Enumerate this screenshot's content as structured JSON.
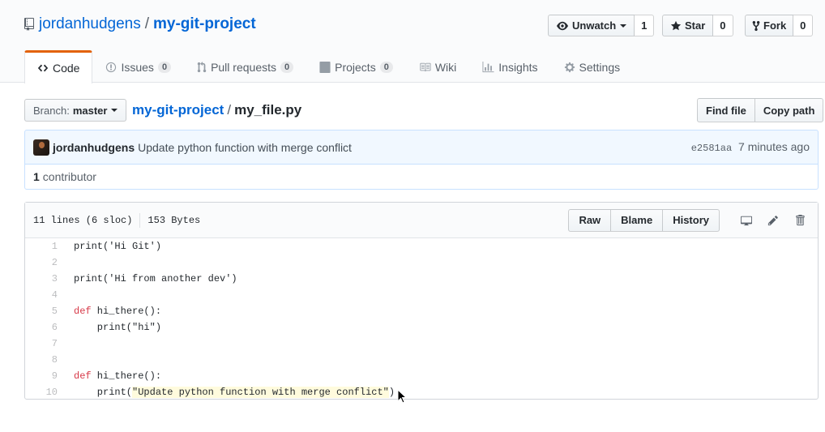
{
  "repo": {
    "owner": "jordanhudgens",
    "separator": "/",
    "name": "my-git-project"
  },
  "actions": {
    "unwatch_label": "Unwatch",
    "watch_count": "1",
    "star_label": "Star",
    "star_count": "0",
    "fork_label": "Fork",
    "fork_count": "0"
  },
  "nav": {
    "code": "Code",
    "issues": "Issues",
    "issues_count": "0",
    "pulls": "Pull requests",
    "pulls_count": "0",
    "projects": "Projects",
    "projects_count": "0",
    "wiki": "Wiki",
    "insights": "Insights",
    "settings": "Settings"
  },
  "branch": {
    "label": "Branch:",
    "name": "master"
  },
  "breadcrumb": {
    "root": "my-git-project",
    "separator": "/",
    "file": "my_file.py"
  },
  "file_buttons": {
    "find": "Find file",
    "copy": "Copy path"
  },
  "commit": {
    "author": "jordanhudgens",
    "message": "Update python function with merge conflict",
    "sha": "e2581aa",
    "time": "7 minutes ago"
  },
  "contributors": {
    "count": "1",
    "label": "contributor"
  },
  "file": {
    "lines": "11 lines (6 sloc)",
    "size": "153 Bytes",
    "raw": "Raw",
    "blame": "Blame",
    "history": "History"
  },
  "code_lines": [
    {
      "num": "1",
      "text": "print('Hi Git')"
    },
    {
      "num": "2",
      "text": ""
    },
    {
      "num": "3",
      "text": "print('Hi from another dev')"
    },
    {
      "num": "4",
      "text": ""
    },
    {
      "num": "5",
      "kw": "def",
      "text": " hi_there():"
    },
    {
      "num": "6",
      "text": "    print(\"hi\")"
    },
    {
      "num": "7",
      "text": ""
    },
    {
      "num": "8",
      "text": ""
    },
    {
      "num": "9",
      "kw": "def",
      "text": " hi_there():"
    },
    {
      "num": "10",
      "pre": "    print(",
      "hl": "\"Update python function with merge conflict\"",
      "post": ")"
    }
  ],
  "colors": {
    "link": "#0366d6",
    "tab_accent": "#e36209",
    "keyword": "#d73a49",
    "highlight": "#fffbdd"
  }
}
